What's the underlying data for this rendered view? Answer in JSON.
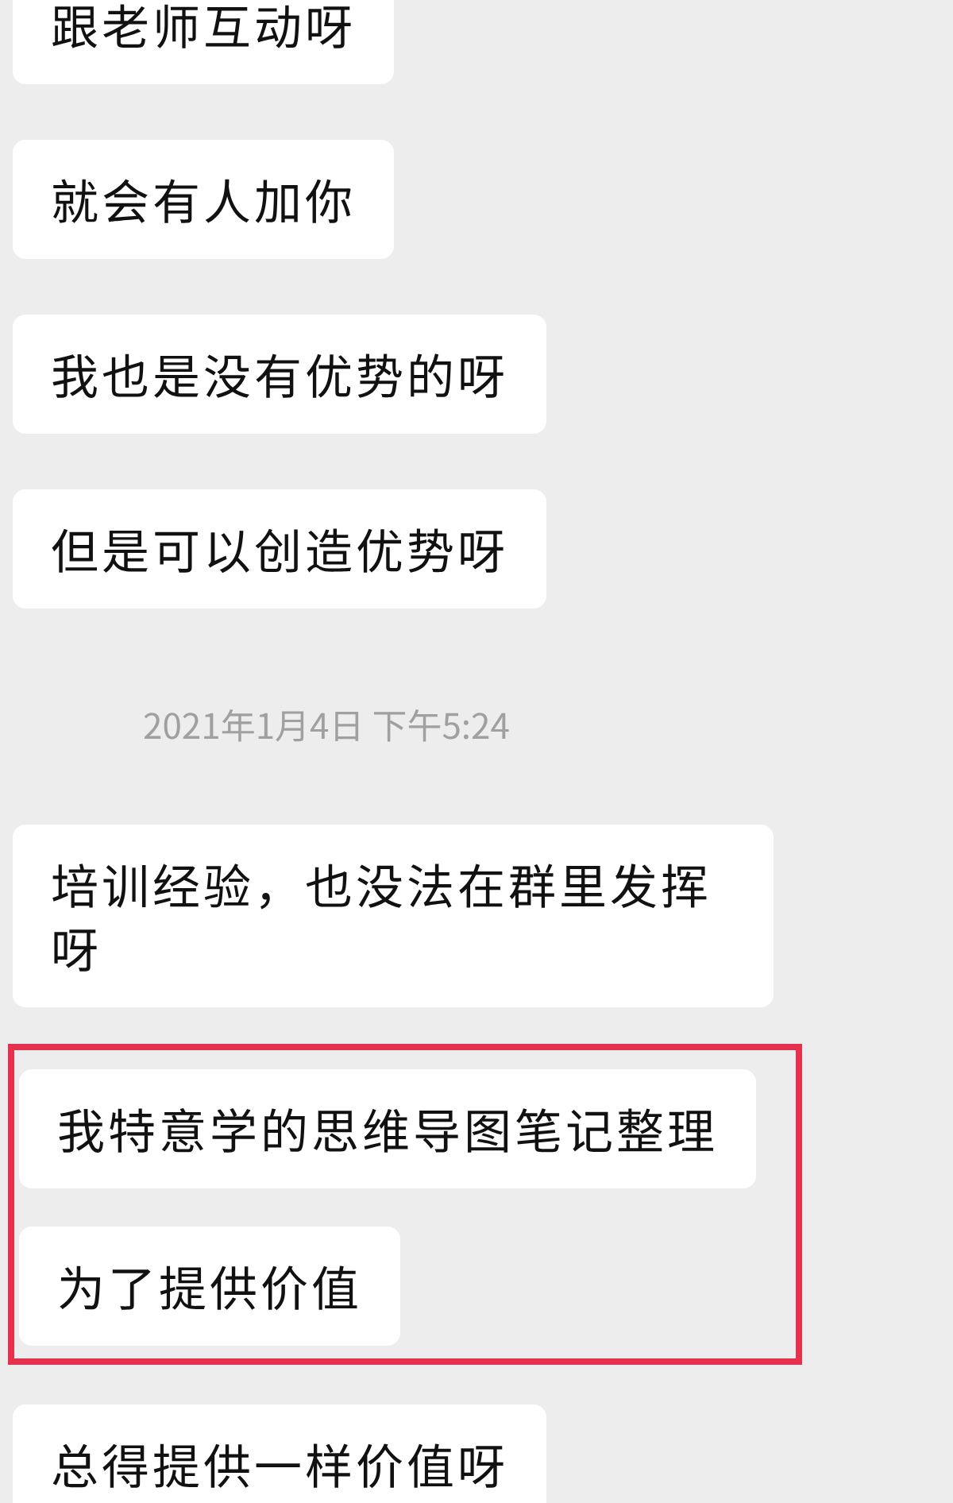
{
  "messages": [
    {
      "kind": "bubble",
      "text": "跟老师互动呀"
    },
    {
      "kind": "bubble",
      "text": "就会有人加你"
    },
    {
      "kind": "bubble",
      "text": "我也是没有优势的呀"
    },
    {
      "kind": "bubble",
      "text": "但是可以创造优势呀"
    },
    {
      "kind": "timestamp",
      "text": "2021年1月4日 下午5:24"
    },
    {
      "kind": "bubble",
      "text": "培训经验，也没法在群里发挥呀"
    },
    {
      "kind": "highlight",
      "messages": [
        {
          "kind": "bubble",
          "text": "我特意学的思维导图笔记整理"
        },
        {
          "kind": "bubble",
          "text": "为了提供价值"
        }
      ]
    },
    {
      "kind": "bubble",
      "text": "总得提供一样价值呀"
    }
  ]
}
